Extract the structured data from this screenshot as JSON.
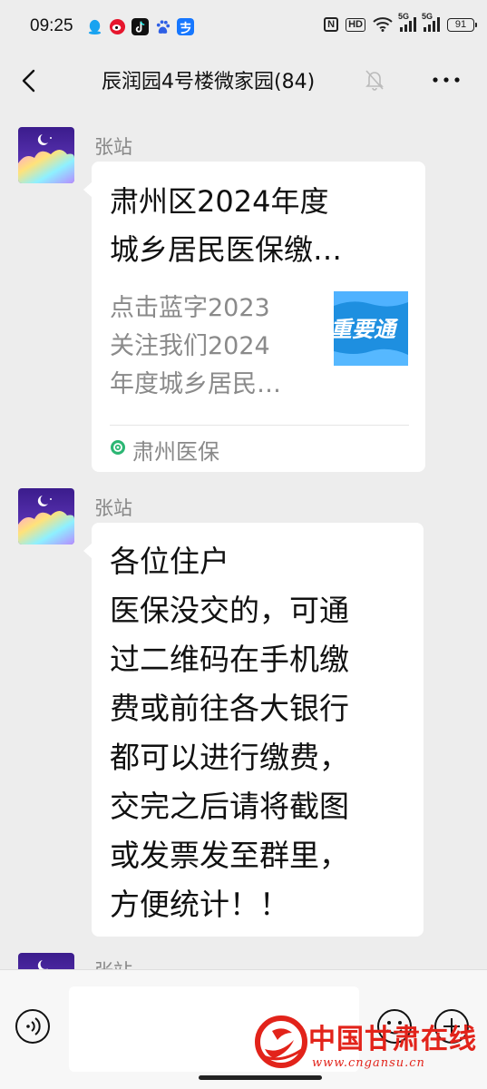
{
  "status_bar": {
    "time": "09:25",
    "battery": "91",
    "nfc_label": "N",
    "hd_label": "HD",
    "network_label_1": "5G",
    "network_label_2": "5G",
    "app_icons": [
      "qq-icon",
      "weibo-icon",
      "tiktok-icon",
      "baidu-icon",
      "alipay-icon"
    ]
  },
  "header": {
    "title": "辰润园4号楼微家园(84)",
    "icons": [
      "back-arrow-icon",
      "mute-bell-icon",
      "more-dots-icon"
    ]
  },
  "messages": [
    {
      "sender": "张站",
      "type": "link-card",
      "card": {
        "title": "肃州区2024年度城乡居民医保缴…",
        "title_line1": "肃州区2024年度",
        "title_line2": "城乡居民医保缴…",
        "description": "点击蓝字2023关注我们2024年度城乡居民…",
        "description_line1": "点击蓝字2023",
        "description_line2": "关注我们2024",
        "description_line3": "年度城乡居民…",
        "thumbnail_text": "重要通",
        "source": "肃州医保"
      }
    },
    {
      "sender": "张站",
      "type": "text",
      "lines": [
        "各位住户",
        "医保没交的，可通",
        "过二维码在手机缴",
        "费或前往各大银行",
        "都可以进行缴费，",
        "交完之后请将截图",
        "或发票发至群里，",
        "方便统计！！"
      ]
    },
    {
      "sender": "张站",
      "type": "partial"
    }
  ],
  "input_bar": {
    "placeholder": "",
    "icons": [
      "voice-icon",
      "emoji-icon",
      "plus-icon"
    ]
  },
  "watermark": {
    "name": "中国甘肃在线",
    "url": "www.cngansu.cn"
  },
  "colors": {
    "background": "#ededed",
    "bubble": "#ffffff",
    "card_thumb_blue": "#1e8fe0",
    "watermark_red": "#e2231a",
    "source_icon_green": "#2bb673"
  }
}
